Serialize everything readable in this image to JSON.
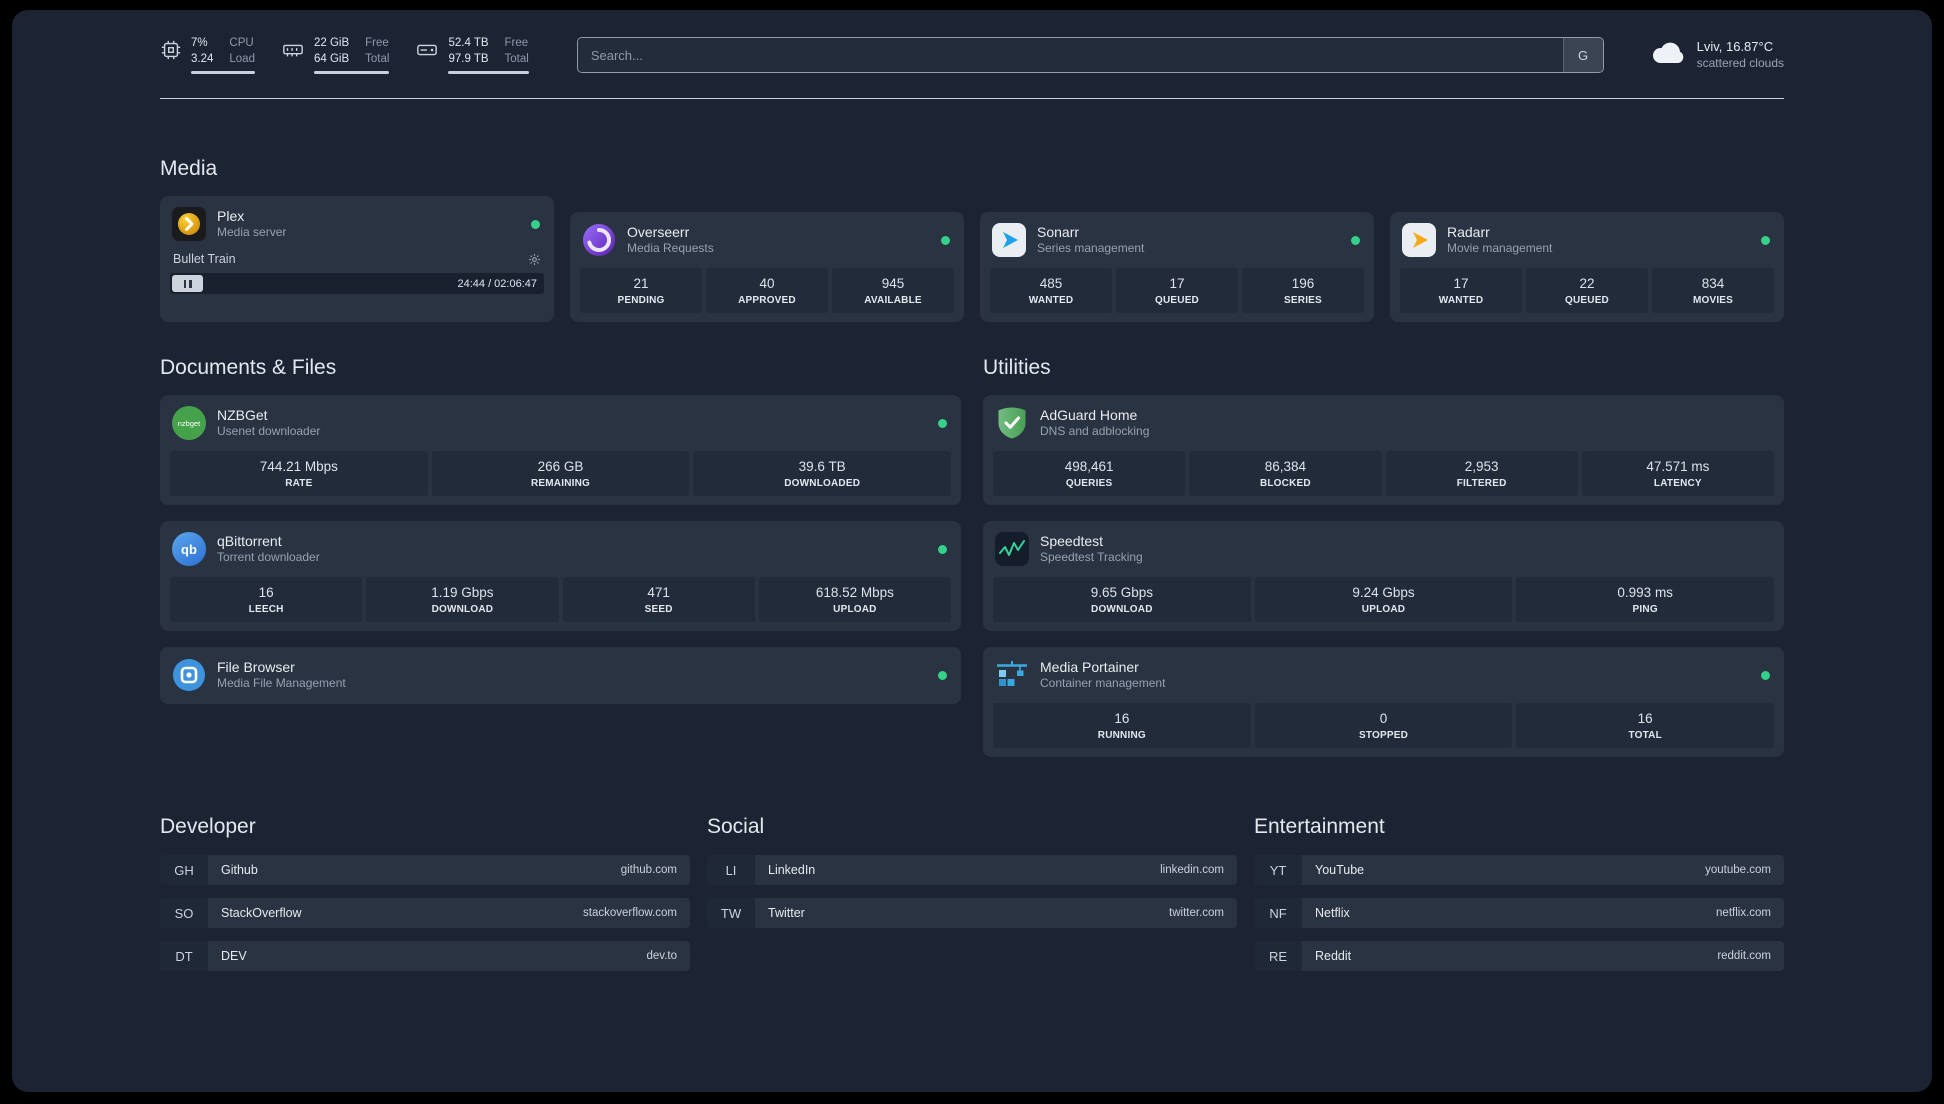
{
  "topbar": {
    "cpu": {
      "value_top": "7%",
      "value_bottom": "3.24",
      "label_top": "CPU",
      "label_bottom": "Load"
    },
    "memory": {
      "value_top": "22 GiB",
      "value_bottom": "64 GiB",
      "label_top": "Free",
      "label_bottom": "Total"
    },
    "disk": {
      "value_top": "52.4 TB",
      "value_bottom": "97.9 TB",
      "label_top": "Free",
      "label_bottom": "Total"
    },
    "search": {
      "placeholder": "Search...",
      "provider": "G"
    },
    "weather": {
      "location": "Lviv, 16.87°C",
      "condition": "scattered clouds"
    }
  },
  "sections": {
    "media": {
      "title": "Media",
      "plex": {
        "name": "Plex",
        "desc": "Media server",
        "now_playing": {
          "title": "Bullet Train",
          "time": "24:44 / 02:06:47"
        }
      },
      "overseerr": {
        "name": "Overseerr",
        "desc": "Media Requests",
        "stats": [
          {
            "value": "21",
            "label": "PENDING"
          },
          {
            "value": "40",
            "label": "APPROVED"
          },
          {
            "value": "945",
            "label": "AVAILABLE"
          }
        ]
      },
      "sonarr": {
        "name": "Sonarr",
        "desc": "Series management",
        "stats": [
          {
            "value": "485",
            "label": "WANTED"
          },
          {
            "value": "17",
            "label": "QUEUED"
          },
          {
            "value": "196",
            "label": "SERIES"
          }
        ]
      },
      "radarr": {
        "name": "Radarr",
        "desc": "Movie management",
        "stats": [
          {
            "value": "17",
            "label": "WANTED"
          },
          {
            "value": "22",
            "label": "QUEUED"
          },
          {
            "value": "834",
            "label": "MOVIES"
          }
        ]
      }
    },
    "documents": {
      "title": "Documents & Files",
      "nzbget": {
        "name": "NZBGet",
        "desc": "Usenet downloader",
        "icon_text": "nzbget",
        "stats": [
          {
            "value": "744.21 Mbps",
            "label": "RATE"
          },
          {
            "value": "266 GB",
            "label": "REMAINING"
          },
          {
            "value": "39.6 TB",
            "label": "DOWNLOADED"
          }
        ]
      },
      "qbittorrent": {
        "name": "qBittorrent",
        "desc": "Torrent downloader",
        "icon_text": "qb",
        "stats": [
          {
            "value": "16",
            "label": "LEECH"
          },
          {
            "value": "1.19 Gbps",
            "label": "DOWNLOAD"
          },
          {
            "value": "471",
            "label": "SEED"
          },
          {
            "value": "618.52 Mbps",
            "label": "UPLOAD"
          }
        ]
      },
      "filebrowser": {
        "name": "File Browser",
        "desc": "Media File Management"
      }
    },
    "utilities": {
      "title": "Utilities",
      "adguard": {
        "name": "AdGuard Home",
        "desc": "DNS and adblocking",
        "stats": [
          {
            "value": "498,461",
            "label": "QUERIES"
          },
          {
            "value": "86,384",
            "label": "BLOCKED"
          },
          {
            "value": "2,953",
            "label": "FILTERED"
          },
          {
            "value": "47.571 ms",
            "label": "LATENCY"
          }
        ]
      },
      "speedtest": {
        "name": "Speedtest",
        "desc": "Speedtest Tracking",
        "stats": [
          {
            "value": "9.65 Gbps",
            "label": "DOWNLOAD"
          },
          {
            "value": "9.24 Gbps",
            "label": "UPLOAD"
          },
          {
            "value": "0.993 ms",
            "label": "PING"
          }
        ]
      },
      "portainer": {
        "name": "Media Portainer",
        "desc": "Container management",
        "stats": [
          {
            "value": "16",
            "label": "RUNNING"
          },
          {
            "value": "0",
            "label": "STOPPED"
          },
          {
            "value": "16",
            "label": "TOTAL"
          }
        ]
      }
    },
    "bookmarks": {
      "developer": {
        "title": "Developer",
        "items": [
          {
            "abbr": "GH",
            "name": "Github",
            "url": "github.com"
          },
          {
            "abbr": "SO",
            "name": "StackOverflow",
            "url": "stackoverflow.com"
          },
          {
            "abbr": "DT",
            "name": "DEV",
            "url": "dev.to"
          }
        ]
      },
      "social": {
        "title": "Social",
        "items": [
          {
            "abbr": "LI",
            "name": "LinkedIn",
            "url": "linkedin.com"
          },
          {
            "abbr": "TW",
            "name": "Twitter",
            "url": "twitter.com"
          }
        ]
      },
      "entertainment": {
        "title": "Entertainment",
        "items": [
          {
            "abbr": "YT",
            "name": "YouTube",
            "url": "youtube.com"
          },
          {
            "abbr": "NF",
            "name": "Netflix",
            "url": "netflix.com"
          },
          {
            "abbr": "RE",
            "name": "Reddit",
            "url": "reddit.com"
          }
        ]
      }
    }
  },
  "colors": {
    "accent_green": "#35d089",
    "background": "#1c2433",
    "card": "#2a3341"
  }
}
